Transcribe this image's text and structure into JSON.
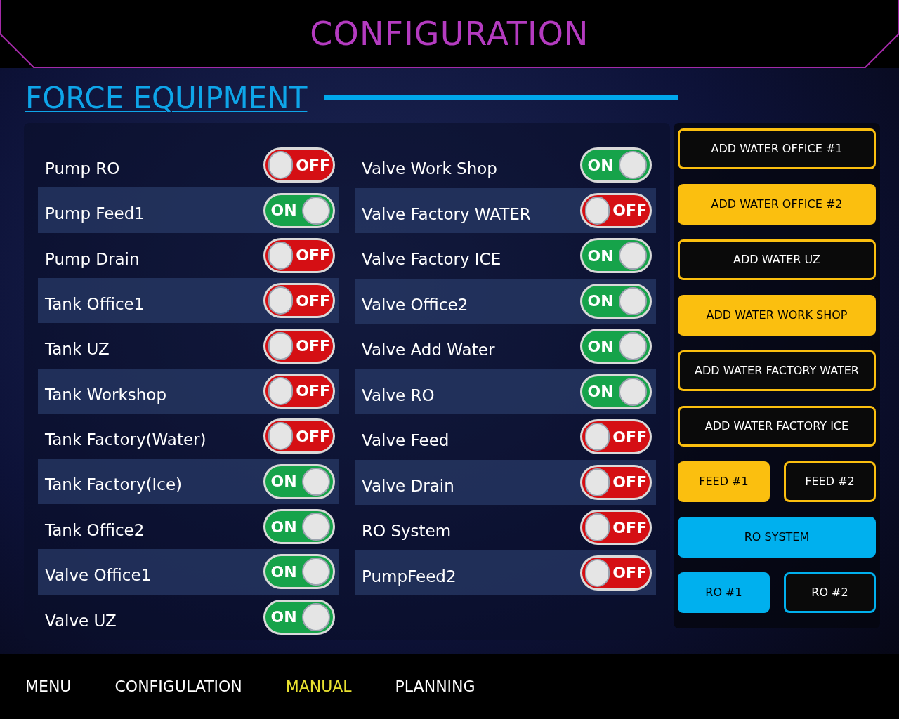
{
  "header": {
    "title": "CONFIGURATION"
  },
  "section": {
    "title": "FORCE EQUIPMENT"
  },
  "columns": [
    {
      "items": [
        {
          "name": "Pump RO",
          "on": false,
          "switch_label": "OFF"
        },
        {
          "name": "Pump Feed1",
          "on": true,
          "switch_label": "ON"
        },
        {
          "name": "Pump Drain",
          "on": false,
          "switch_label": "OFF"
        },
        {
          "name": "Tank Office1",
          "on": false,
          "switch_label": "OFF"
        },
        {
          "name": "Tank UZ",
          "on": false,
          "switch_label": "OFF"
        },
        {
          "name": "Tank Workshop",
          "on": false,
          "switch_label": "OFF"
        },
        {
          "name": "Tank Factory(Water)",
          "on": false,
          "switch_label": "OFF"
        },
        {
          "name": "Tank Factory(Ice)",
          "on": true,
          "switch_label": "ON"
        },
        {
          "name": "Tank Office2",
          "on": true,
          "switch_label": "ON"
        },
        {
          "name": "Valve Office1",
          "on": true,
          "switch_label": "ON"
        },
        {
          "name": "Valve UZ",
          "on": true,
          "switch_label": "ON"
        }
      ]
    },
    {
      "items": [
        {
          "name": "Valve Work Shop",
          "on": true,
          "switch_label": "ON"
        },
        {
          "name": "Valve Factory WATER",
          "on": false,
          "switch_label": "OFF"
        },
        {
          "name": "Valve Factory ICE",
          "on": true,
          "switch_label": "ON"
        },
        {
          "name": "Valve Office2",
          "on": true,
          "switch_label": "ON"
        },
        {
          "name": "Valve Add Water",
          "on": true,
          "switch_label": "ON"
        },
        {
          "name": "Valve RO",
          "on": true,
          "switch_label": "ON"
        },
        {
          "name": "Valve Feed",
          "on": false,
          "switch_label": "OFF"
        },
        {
          "name": "Valve Drain",
          "on": false,
          "switch_label": "OFF"
        },
        {
          "name": "RO System",
          "on": false,
          "switch_label": "OFF"
        },
        {
          "name": "PumpFeed2",
          "on": false,
          "switch_label": "OFF"
        }
      ]
    }
  ],
  "actions": [
    [
      {
        "label": "ADD WATER OFFICE #1",
        "color": "#fbbf0f",
        "filled": false
      }
    ],
    [
      {
        "label": "ADD WATER OFFICE #2",
        "color": "#fbbf0f",
        "filled": true
      }
    ],
    [
      {
        "label": "ADD WATER UZ",
        "color": "#fbbf0f",
        "filled": false
      }
    ],
    [
      {
        "label": "ADD WATER WORK SHOP",
        "color": "#fbbf0f",
        "filled": true
      }
    ],
    [
      {
        "label": "ADD WATER FACTORY WATER",
        "color": "#fbbf0f",
        "filled": false
      }
    ],
    [
      {
        "label": "ADD WATER FACTORY ICE",
        "color": "#fbbf0f",
        "filled": false
      }
    ],
    [
      {
        "label": "FEED #1",
        "color": "#fbbf0f",
        "filled": true
      },
      {
        "label": "FEED #2",
        "color": "#fbbf0f",
        "filled": false
      }
    ],
    [
      {
        "label": "RO SYSTEM",
        "color": "#00b0ee",
        "filled": true
      }
    ],
    [
      {
        "label": "RO #1",
        "color": "#00b0ee",
        "filled": true
      },
      {
        "label": "RO #2",
        "color": "#00b0ee",
        "filled": false
      }
    ]
  ],
  "nav": [
    {
      "label": "MENU",
      "selected": false
    },
    {
      "label": "CONFIGULATION",
      "selected": false
    },
    {
      "label": "MANUAL",
      "selected": true
    },
    {
      "label": "PLANNING",
      "selected": false
    }
  ]
}
